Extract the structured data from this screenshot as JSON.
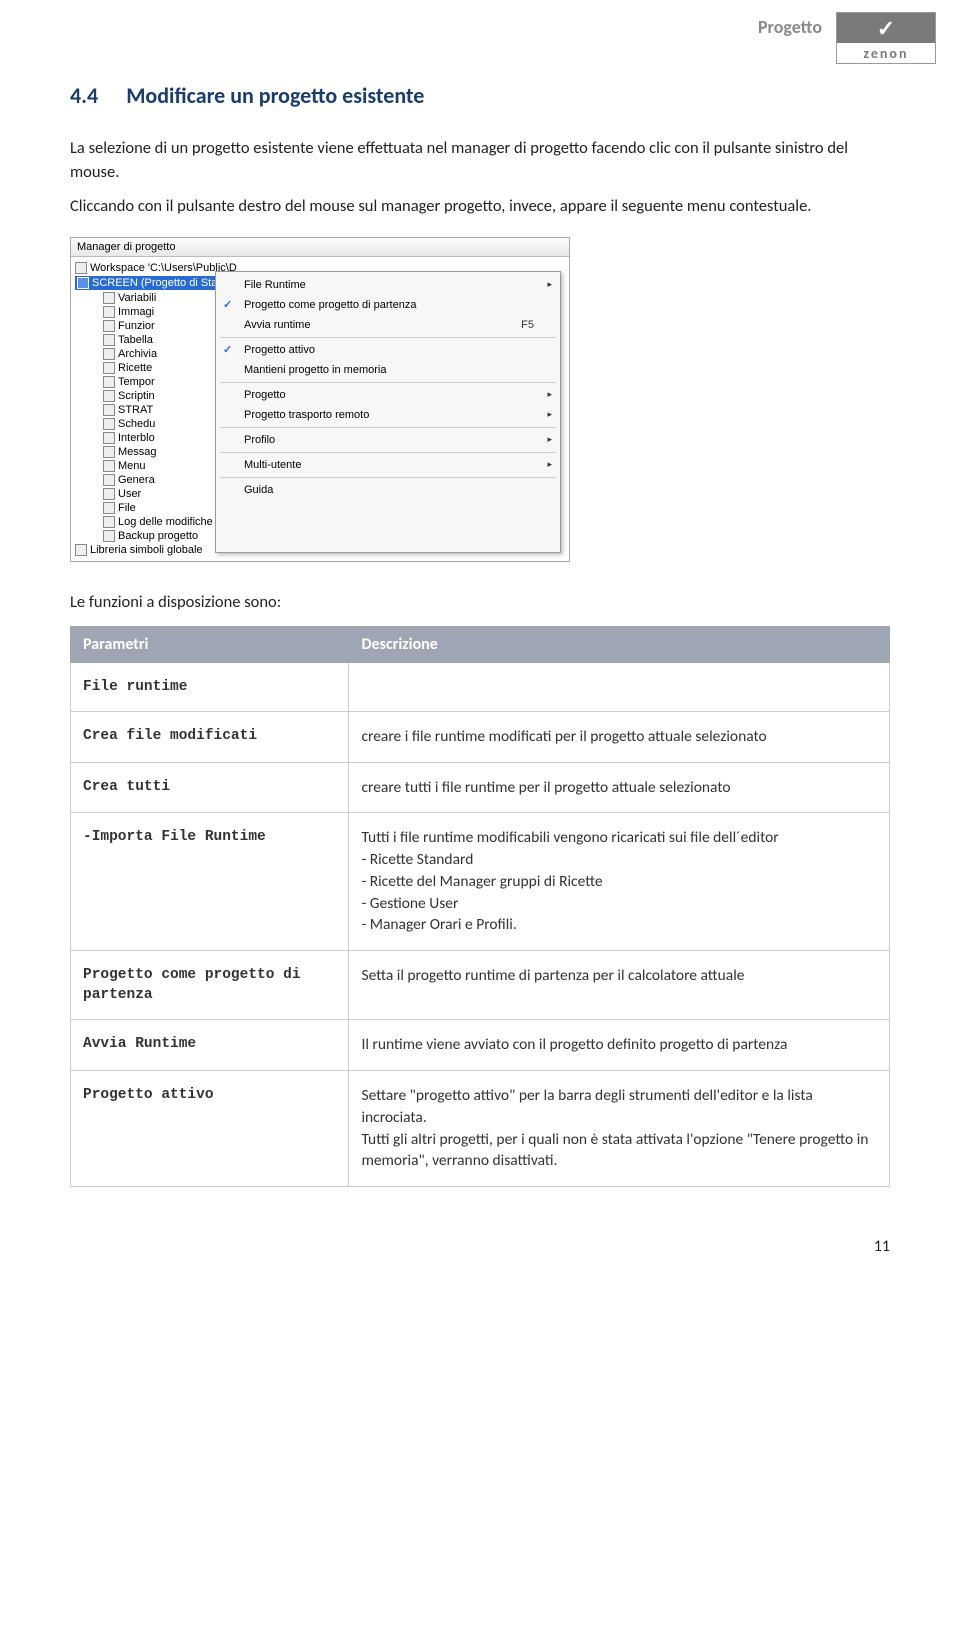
{
  "header": {
    "label": "Progetto",
    "logo_text": "zenon"
  },
  "section": {
    "number": "4.4",
    "title": "Modificare un progetto esistente"
  },
  "paragraphs": {
    "p1": "La selezione di un progetto esistente viene effettuata nel manager di progetto facendo clic con il pulsante sinistro del mouse.",
    "p2": "Cliccando con il pulsante destro del mouse sul manager progetto, invece, appare il seguente menu contestuale."
  },
  "screenshot": {
    "title": "Manager di progetto",
    "workspace": "Workspace 'C:\\Users\\Public\\D",
    "selected": "SCREEN (Progetto di Start)",
    "tree_items": [
      "Variabili",
      "Immagi",
      "Funzior",
      "Tabella",
      "Archivia",
      "Ricette",
      "Tempor",
      "Scriptin",
      "STRAT",
      "Schedu",
      "Interblo",
      "Messag",
      "Menu",
      "Genera",
      "User",
      "File",
      "Log delle modifiche",
      "Backup progetto"
    ],
    "tree_last": "Libreria simboli globale",
    "menu": {
      "file_runtime": "File Runtime",
      "proj_partenza": "Progetto come progetto di partenza",
      "avvia_runtime": "Avvia runtime",
      "avvia_shortcut": "F5",
      "progetto_attivo": "Progetto attivo",
      "mantieni": "Mantieni progetto in memoria",
      "progetto": "Progetto",
      "trasporto": "Progetto trasporto remoto",
      "profilo": "Profilo",
      "multi": "Multi-utente",
      "guida": "Guida"
    }
  },
  "functions_intro": "Le funzioni a disposizione sono:",
  "table": {
    "header_param": "Parametri",
    "header_desc": "Descrizione",
    "rows": {
      "file_runtime": {
        "param": "File runtime",
        "desc": ""
      },
      "crea_modificati": {
        "param": "Crea file modificati",
        "desc": "creare i file runtime modificati per il progetto attuale selezionato"
      },
      "crea_tutti": {
        "param": "Crea tutti",
        "desc": "creare tutti i file runtime per il progetto attuale selezionato"
      },
      "importa": {
        "param": "-Importa File Runtime",
        "desc": "Tutti i file runtime modificabili vengono ricaricati sui file dell´editor\n- Ricette Standard\n- Ricette del Manager gruppi di Ricette\n- Gestione User\n- Manager Orari e Profili."
      },
      "proj_partenza": {
        "param": "Progetto come progetto di partenza",
        "desc": "Setta il progetto runtime di partenza per il calcolatore attuale"
      },
      "avvia": {
        "param": "Avvia Runtime",
        "desc": "Il runtime viene avviato con il progetto definito progetto di partenza"
      },
      "attivo": {
        "param": "Progetto attivo",
        "desc": "Settare \"progetto attivo\" per la barra degli strumenti dell'editor e la lista incrociata.\nTutti gli altri progetti, per i quali non è stata attivata l'opzione \"Tenere progetto in memoria\", verranno disattivati."
      }
    }
  },
  "page_number": "11"
}
